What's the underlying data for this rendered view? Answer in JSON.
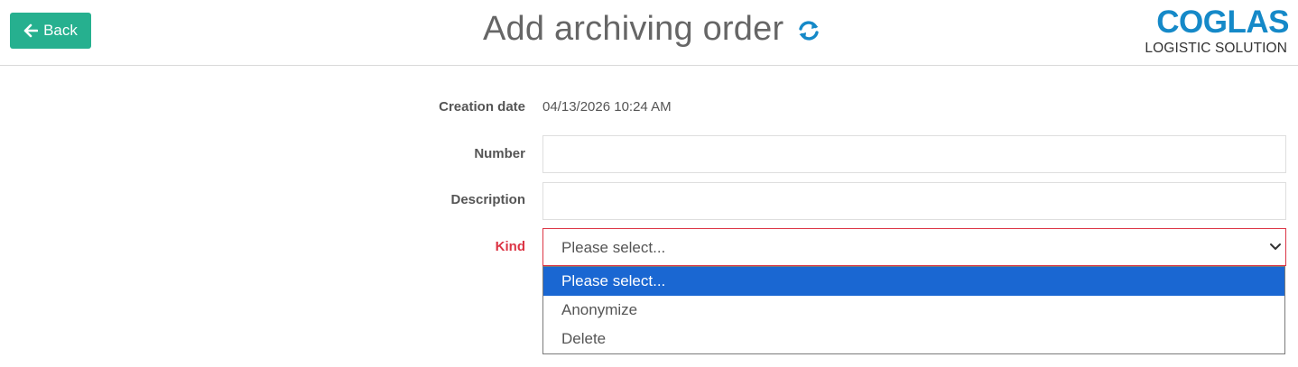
{
  "header": {
    "back_label": "Back",
    "title": "Add archiving order",
    "logo_main": "COGLAS",
    "logo_sub": "LOGISTIC SOLUTION"
  },
  "form": {
    "creation_date": {
      "label": "Creation date",
      "value": "04/13/2026 10:24 AM"
    },
    "number": {
      "label": "Number",
      "value": ""
    },
    "description": {
      "label": "Description",
      "value": ""
    },
    "kind": {
      "label": "Kind",
      "selected": "Please select...",
      "options": [
        "Please select...",
        "Anonymize",
        "Delete"
      ],
      "highlighted_index": 0
    }
  },
  "colors": {
    "accent": "#26b08f",
    "brand": "#1589c8",
    "required": "#dc3545",
    "highlight": "#1a67d2"
  },
  "icons": [
    "arrow-left-icon",
    "refresh-icon",
    "chevron-down-icon"
  ]
}
